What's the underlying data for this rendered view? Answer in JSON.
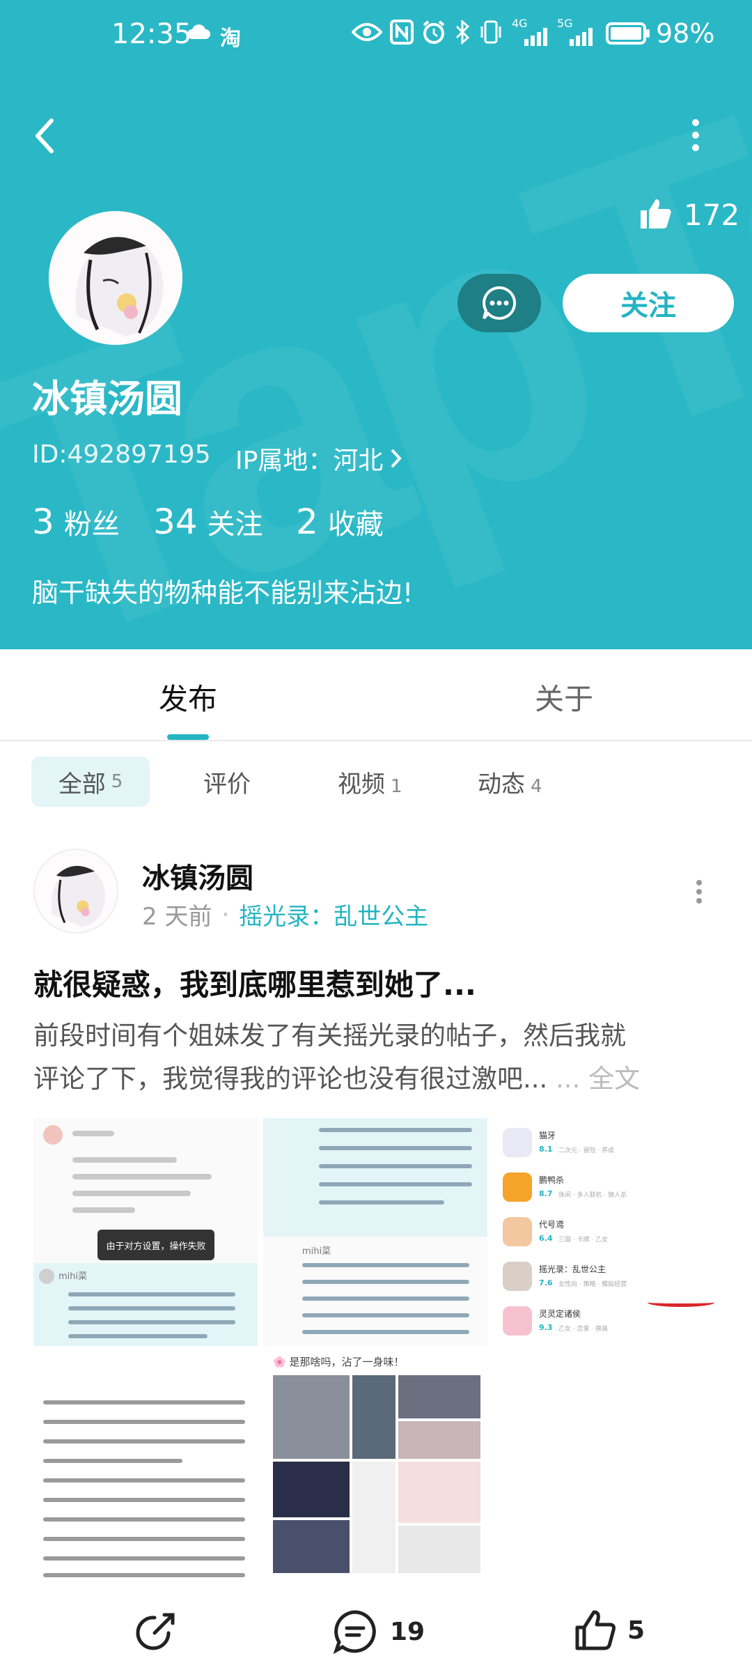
{
  "status_bar": {
    "time": "12:35",
    "carrier_icon_text": "淘",
    "network_4g": "4G",
    "network_5g": "5G",
    "battery": "98%"
  },
  "profile": {
    "likes": "172",
    "follow_label": "关注",
    "name": "冰镇汤圆",
    "id": "ID:492897195",
    "ip_location": "IP属地：河北",
    "stats": {
      "fans_num": "3",
      "fans_label": "粉丝",
      "following_num": "34",
      "following_label": "关注",
      "favorites_num": "2",
      "favorites_label": "收藏"
    },
    "bio": "脑干缺失的物种能不能别来沾边!"
  },
  "tabs": [
    {
      "label": "发布",
      "active": true
    },
    {
      "label": "关于",
      "active": false
    }
  ],
  "filters": [
    {
      "label": "全部",
      "count": "5"
    },
    {
      "label": "评价",
      "count": ""
    },
    {
      "label": "视频",
      "count": "1"
    },
    {
      "label": "动态",
      "count": "4"
    }
  ],
  "post": {
    "author": "冰镇汤圆",
    "time": "2 天前",
    "separator": "·",
    "game": "摇光录：乱世公主",
    "title": "就很疑惑，我到底哪里惹到她了...",
    "excerpt_line1": "前段时间有个姐妹发了有关摇光录的帖子，然后我就",
    "excerpt_line2": "评论了下，我觉得我的评论也没有很过激吧... ",
    "full_text_link": "... 全文",
    "images": {
      "img1_toast": "由于对方设置，操作失败",
      "img1_user": "mihi菜",
      "img2_user": "mihi菜",
      "img5_caption": "🌸 是那啥吗，沾了一身味！"
    },
    "game_list": [
      {
        "name": "猫牙",
        "score": "8.1",
        "meta": "二次元 · 冒险 · 养成"
      },
      {
        "name": "鹏鸭杀",
        "score": "8.7",
        "meta": "休闲 · 多人联机 · 狼人杀"
      },
      {
        "name": "代号鸢",
        "score": "6.4",
        "meta": "三国 · 卡牌 · 乙女"
      },
      {
        "name": "摇光录：乱世公主",
        "score": "7.6",
        "meta": "女性向 · 策略 · 模拟经营"
      },
      {
        "name": "灵灵定诸侯",
        "score": "9.3",
        "meta": "乙女 · 恋爱 · 换装"
      }
    ],
    "actions": {
      "share": "",
      "comments": "19",
      "likes": "5"
    }
  },
  "colors": {
    "header_bg": "#2ab8c6",
    "accent": "#24b4c2",
    "message_btn": "#1e7f85",
    "chip_bg": "#e3f5f7",
    "underline_red": "#d9262b"
  }
}
